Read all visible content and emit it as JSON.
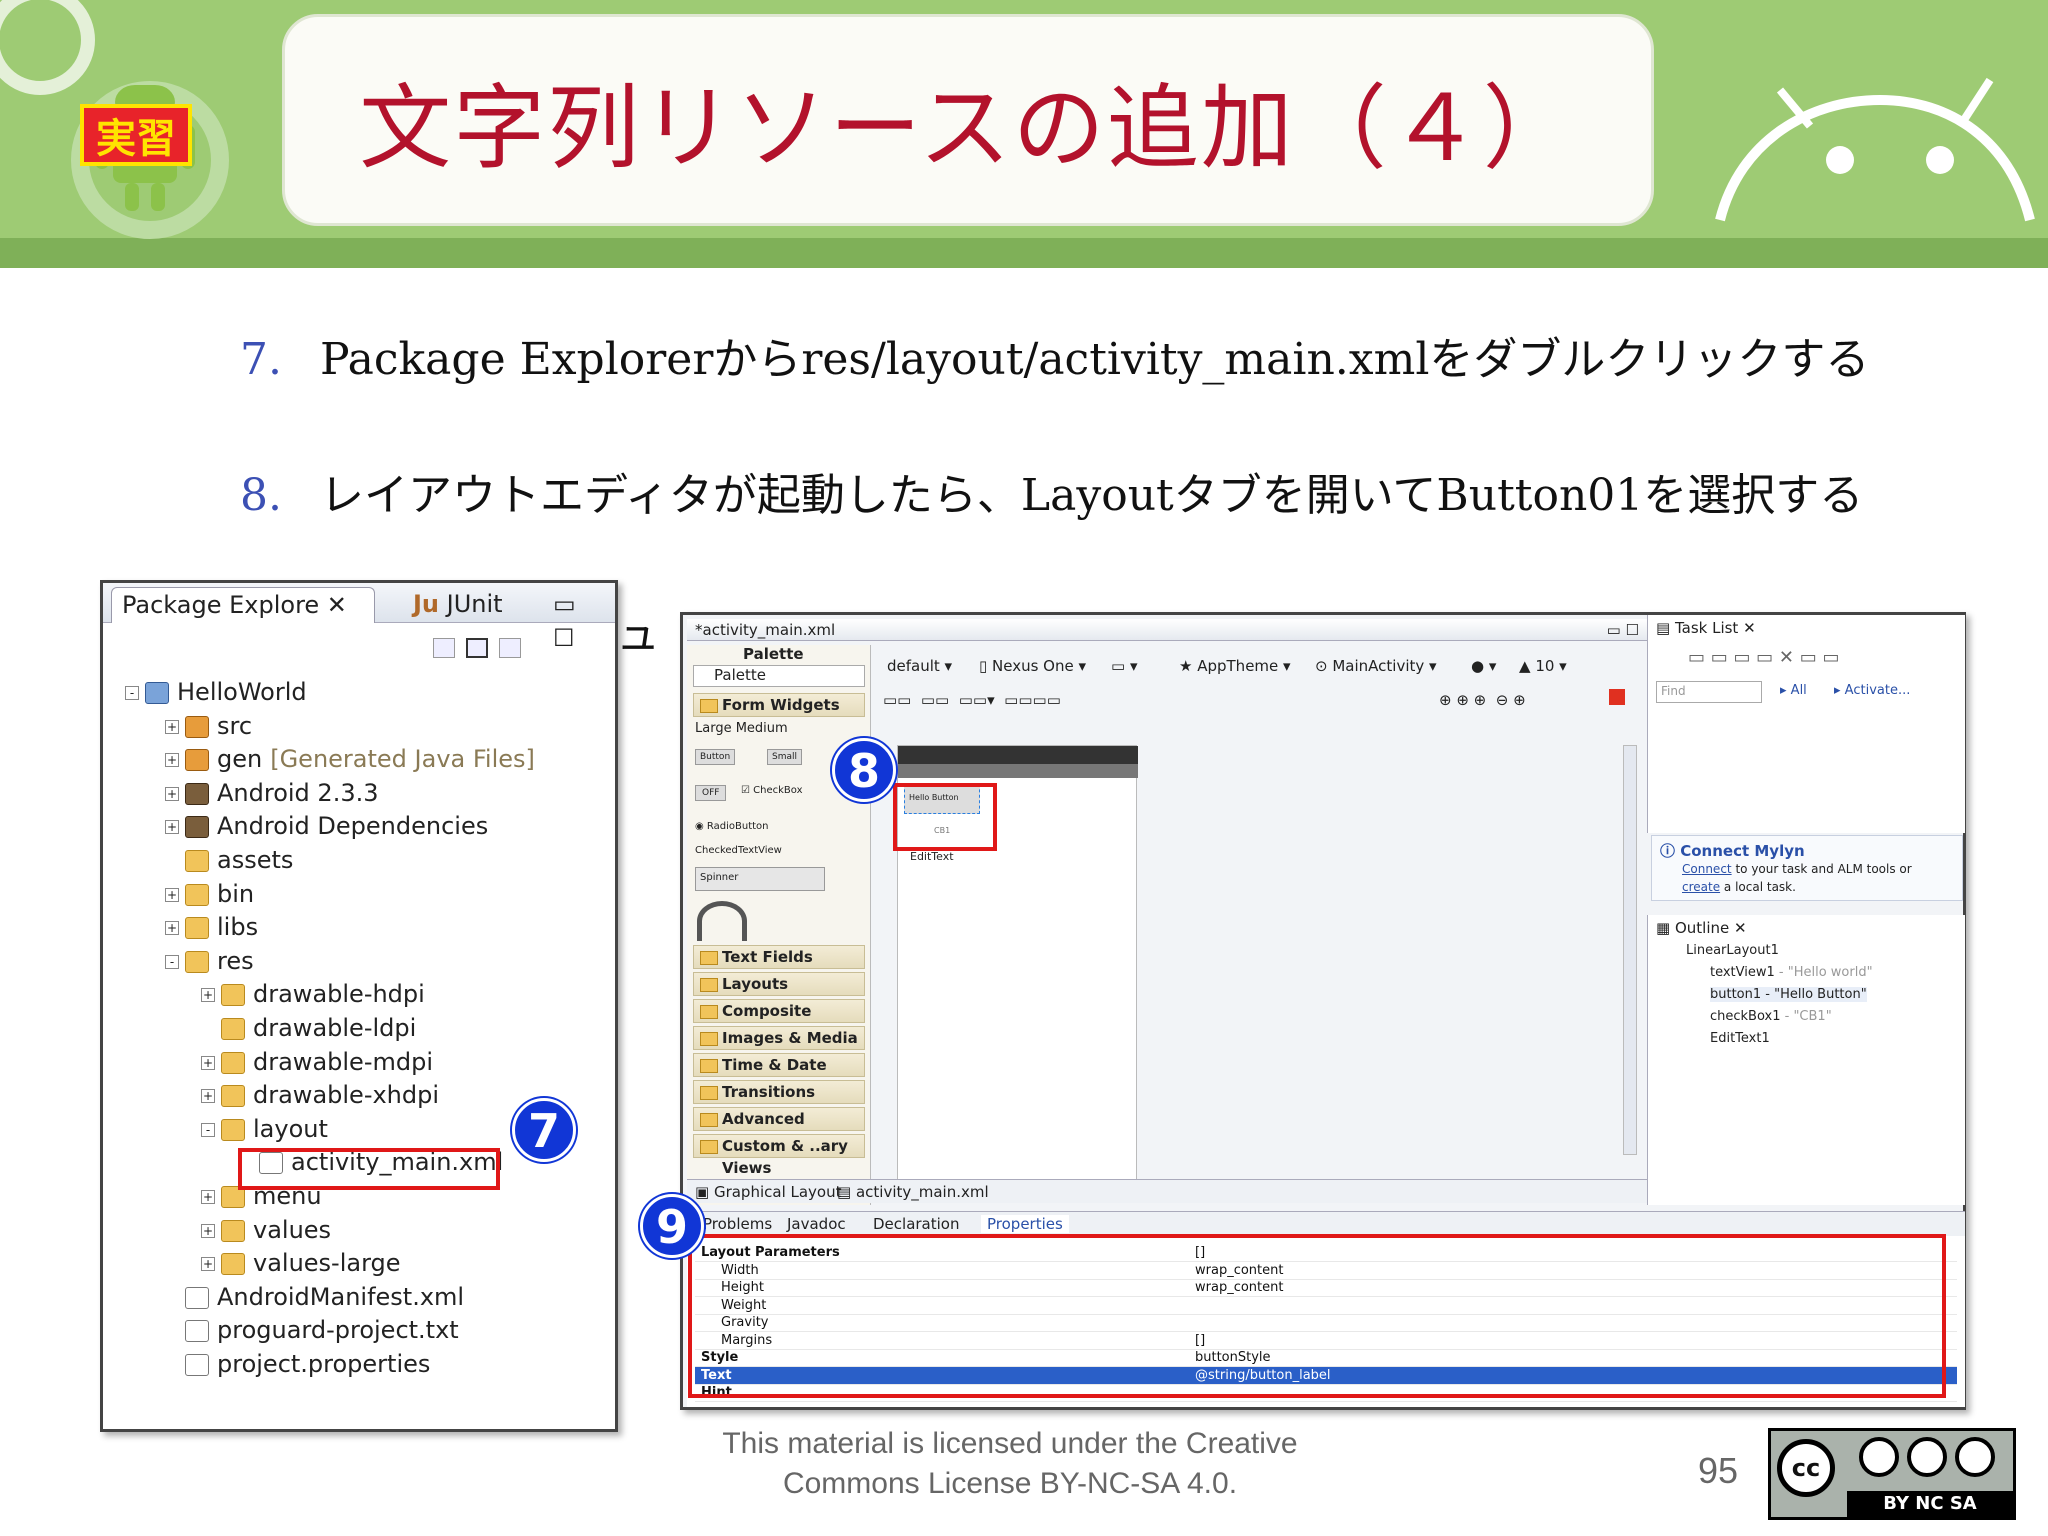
{
  "header": {
    "title": "文字列リソースの追加（４）",
    "badge": "実習"
  },
  "steps": [
    {
      "num": "7.",
      "text": "Package Explorerからres/layout/activity_main.xmlをダブルクリックする"
    },
    {
      "num": "8.",
      "text": "レイアウトエディタが起動したら、Layoutタブを開いてButton01を選択する"
    }
  ],
  "package_explorer": {
    "tabs": {
      "package": "Package Explore",
      "junit": "JUnit"
    },
    "tree": [
      {
        "label": "HelloWorld",
        "extra": ""
      },
      {
        "label": "src",
        "extra": ""
      },
      {
        "label": "gen",
        "extra": "[Generated Java Files]"
      },
      {
        "label": "Android 2.3.3",
        "extra": ""
      },
      {
        "label": "Android Dependencies",
        "extra": ""
      },
      {
        "label": "assets",
        "extra": ""
      },
      {
        "label": "bin",
        "extra": ""
      },
      {
        "label": "libs",
        "extra": ""
      },
      {
        "label": "res",
        "extra": ""
      },
      {
        "label": "drawable-hdpi",
        "extra": ""
      },
      {
        "label": "drawable-ldpi",
        "extra": ""
      },
      {
        "label": "drawable-mdpi",
        "extra": ""
      },
      {
        "label": "drawable-xhdpi",
        "extra": ""
      },
      {
        "label": "layout",
        "extra": ""
      },
      {
        "label": "activity_main.xml",
        "extra": ""
      },
      {
        "label": "menu",
        "extra": ""
      },
      {
        "label": "values",
        "extra": ""
      },
      {
        "label": "values-large",
        "extra": ""
      },
      {
        "label": "AndroidManifest.xml",
        "extra": ""
      },
      {
        "label": "proguard-project.txt",
        "extra": ""
      },
      {
        "label": "project.properties",
        "extra": ""
      }
    ]
  },
  "markers": {
    "m7": "7",
    "m8": "8",
    "m9": "9"
  },
  "editor": {
    "tab": "*activity_main.xml",
    "palette_title": "Palette",
    "palette_label": "Palette",
    "toolbar": {
      "config": "default",
      "device": "Nexus One",
      "theme": "AppTheme",
      "activity": "MainActivity",
      "api": "10"
    },
    "form_widgets": "Form Widgets",
    "widgets": {
      "sizes": "Large  Medium",
      "button": "Button",
      "small": "Small",
      "off": "OFF",
      "checkbox": "CheckBox",
      "radio": "RadioButton",
      "checked_text": "CheckedTextView",
      "spinner": "Spinner"
    },
    "categories": [
      "Text Fields",
      "Layouts",
      "Composite",
      "Images & Media",
      "Time & Date",
      "Transitions",
      "Advanced",
      "Custom & ..ary Views"
    ],
    "canvas": {
      "button": "Hello Button",
      "cb": "CB1",
      "edittext": "EditText"
    },
    "bottom_tabs": {
      "graphical": "Graphical Layout",
      "xml": "activity_main.xml"
    }
  },
  "tasklist": {
    "title": "Task List",
    "find": "Find",
    "all": "All",
    "activate": "Activate..."
  },
  "mylyn": {
    "title": "Connect Mylyn",
    "line1": "to your task and ALM tools or",
    "connect": "Connect",
    "create": "create",
    "line2": "a local task."
  },
  "outline": {
    "title": "Outline",
    "items": [
      {
        "name": "LinearLayout1",
        "value": ""
      },
      {
        "name": "textView1",
        "value": " - \"Hello world\""
      },
      {
        "name": "button1",
        "value": " - \"Hello Button\""
      },
      {
        "name": "checkBox1",
        "value": " - \"CB1\""
      },
      {
        "name": "EditText1",
        "value": ""
      }
    ]
  },
  "props_tabs": {
    "problems": "Problems",
    "javadoc": "Javadoc",
    "declaration": "Declaration",
    "properties": "Properties"
  },
  "properties": [
    {
      "key": "Layout Parameters",
      "value": "[]",
      "bold": true
    },
    {
      "key": "Width",
      "value": "wrap_content",
      "bold": false
    },
    {
      "key": "Height",
      "value": "wrap_content",
      "bold": false
    },
    {
      "key": "Weight",
      "value": "",
      "bold": false
    },
    {
      "key": "Gravity",
      "value": "",
      "bold": false
    },
    {
      "key": "Margins",
      "value": "[]",
      "bold": false
    },
    {
      "key": "Style",
      "value": "buttonStyle",
      "bold": true
    },
    {
      "key": "Text",
      "value": "@string/button_label",
      "bold": true
    },
    {
      "key": "Hint",
      "value": "",
      "bold": true
    }
  ],
  "footer": {
    "license_line1": "This material is licensed under the Creative",
    "license_line2": "Commons License BY-NC-SA 4.0.",
    "page": "95",
    "cc_text": "BY  NC  SA"
  }
}
